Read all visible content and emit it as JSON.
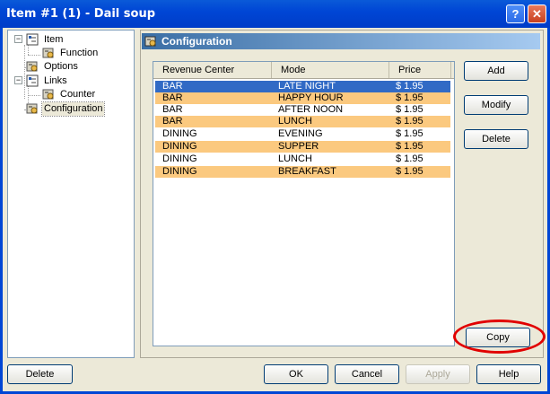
{
  "window": {
    "title": "Item #1 (1) - Dail soup",
    "help_glyph": "?",
    "close_glyph": "✕"
  },
  "tree": {
    "items": [
      {
        "label": "Item",
        "icon": "tree-node-icon"
      },
      {
        "label": "Function",
        "icon": "config-icon"
      },
      {
        "label": "Options",
        "icon": "config-icon"
      },
      {
        "label": "Links",
        "icon": "tree-node-icon"
      },
      {
        "label": "Counter",
        "icon": "config-icon"
      },
      {
        "label": "Configuration",
        "icon": "config-icon"
      }
    ],
    "expander_glyph": "−"
  },
  "panel": {
    "title": "Configuration"
  },
  "grid": {
    "columns": [
      "Revenue Center",
      "Mode",
      "Price"
    ],
    "rows": [
      [
        "BAR",
        "LATE NIGHT",
        "$ 1.95"
      ],
      [
        "BAR",
        "HAPPY HOUR",
        "$ 1.95"
      ],
      [
        "BAR",
        "AFTER NOON",
        "$ 1.95"
      ],
      [
        "BAR",
        "LUNCH",
        "$ 1.95"
      ],
      [
        "DINING",
        "EVENING",
        "$ 1.95"
      ],
      [
        "DINING",
        "SUPPER",
        "$ 1.95"
      ],
      [
        "DINING",
        "LUNCH",
        "$ 1.95"
      ],
      [
        "DINING",
        "BREAKFAST",
        "$ 1.95"
      ]
    ],
    "selected_row": 0
  },
  "side_buttons": {
    "add": "Add",
    "modify": "Modify",
    "delete": "Delete",
    "copy": "Copy"
  },
  "footer_buttons": {
    "delete": "Delete",
    "ok": "OK",
    "cancel": "Cancel",
    "apply": "Apply",
    "help": "Help"
  },
  "colors": {
    "title_bar": "#0046d5",
    "row_selected": "#316ac5",
    "row_alternate": "#fbc97f",
    "highlight_ring": "#e10000"
  }
}
